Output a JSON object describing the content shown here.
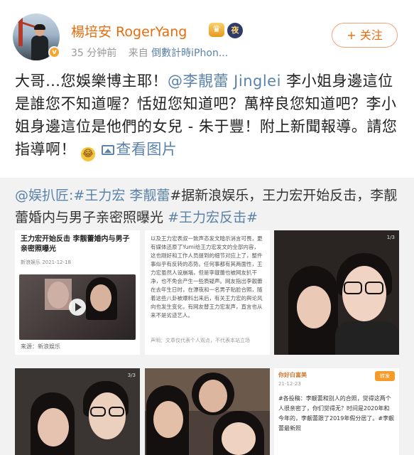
{
  "author": {
    "name": "楊培安 RogerYang",
    "verified_mark": "v",
    "crown_badge": "♛",
    "night_badge": "夜",
    "time": "35 分钟前",
    "via_label": "来自",
    "device": "倒數計時iPhon..."
  },
  "follow_button": "+ 关注",
  "post": {
    "text_1": "大哥…您娛樂博主耶！",
    "mention": "@李靚蕾 Jinglei",
    "text_2": " 李小姐身邊這位是誰您不知道喔？恬妞您知道吧？萬梓良您知道吧？李小姐身邊這位是他們的女兒 - 朱于豐！附上新聞報導。請您指導啊！",
    "emoji": "😂",
    "view_image_label": "查看图片"
  },
  "repost": {
    "mention": "@娱扒匠:",
    "topic_1": "#王力宏 李靓蕾",
    "text_1": "#据新浪娱乐，王力宏开始反击，李靓蕾婚内与男子亲密照曝光",
    "topic_2": "#王力宏反击#"
  },
  "thumbnails": {
    "t1": {
      "headline": "王力宏开始反击 李靓蕾婚内与男子亲密照曝光",
      "source_row": "新浪娱乐  2021-12-18",
      "caption": "来源：新浪娱乐"
    },
    "t2": {
      "body": "以及王力宏表叔一致声态发文暗示消言可畏，更有媒体还原了Yumi给王力宏发文的全部内容，这也刚好和工作人员提到的细节对应上了，整件事似乎有反转的态势。任何事都有其两面性，王力宏虽然人设崩塌，但是李靓蕾也被网友扒干净，也不免会产生一些质疑声。网友指出李靓蕾在去年生日时，在漂夜和一名男子贴脸合照，随着这些八卦被爆料出来后，有关王力宏的舆论风向也发生变化，有网友替王力宏发声，直言也从来不是劣迹艺人。",
      "foot": "声明：文章仅代表个人观点，不代表本站立场"
    },
    "t3": {
      "counter": "1/3"
    },
    "t4": {
      "counter": "3/3"
    },
    "t6": {
      "title": "你好白富美",
      "date": "21-12-23",
      "tag": "转发",
      "body": "#各投稿：李靓蕾和别人的合照，觉得这两个人很亲密了，你们觉得无？时间是2020年和今年的，李靓蕾跟了2019年假分居了。#李靓蕾最新照"
    }
  }
}
